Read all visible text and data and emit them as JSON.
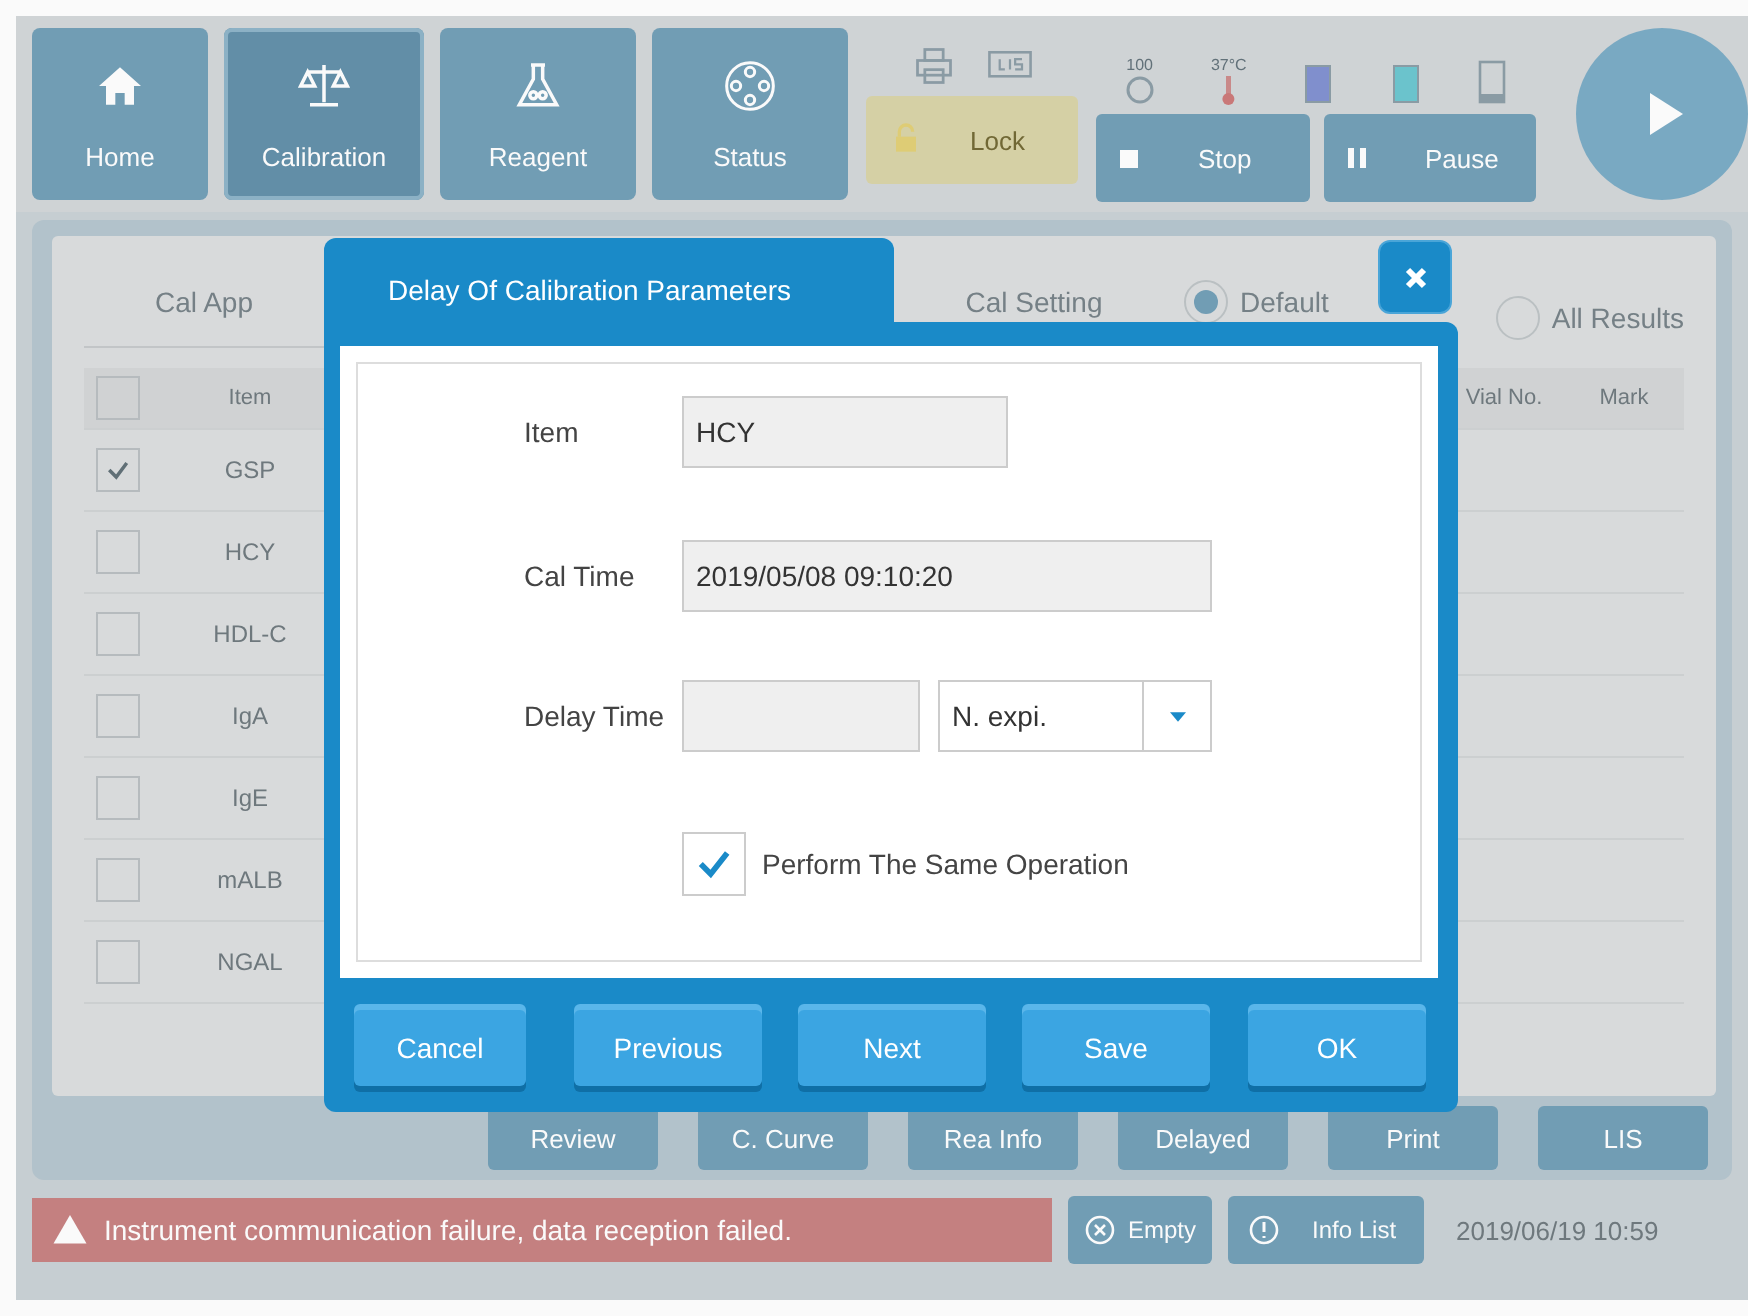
{
  "top_bar": {
    "nav": [
      {
        "label": "Home",
        "selected": false
      },
      {
        "label": "Calibration",
        "selected": true
      },
      {
        "label": "Reagent",
        "selected": false
      },
      {
        "label": "Status",
        "selected": false
      }
    ],
    "sample_count": "100",
    "temperature": "37°C",
    "lock": "Lock",
    "stop": "Stop",
    "pause": "Pause"
  },
  "main": {
    "tabs": [
      {
        "label": "Cal App",
        "selected": false
      },
      {
        "label": "Cal Setting",
        "selected": false
      }
    ],
    "radios": [
      {
        "label": "Default",
        "selected": true
      },
      {
        "label": "All Results",
        "selected": false
      }
    ],
    "table": {
      "columns": [
        "Item",
        "Vial No.",
        "Mark"
      ],
      "header_checked": false,
      "rows": [
        {
          "item": "GSP",
          "checked": true
        },
        {
          "item": "HCY",
          "checked": false
        },
        {
          "item": "HDL-C",
          "checked": false
        },
        {
          "item": "IgA",
          "checked": false
        },
        {
          "item": "IgE",
          "checked": false
        },
        {
          "item": "mALB",
          "checked": false
        },
        {
          "item": "NGAL",
          "checked": false
        }
      ]
    },
    "actions": [
      "Review",
      "C. Curve",
      "Rea Info",
      "Delayed",
      "Print",
      "LIS"
    ]
  },
  "status_bar": {
    "alert": "Instrument communication failure, data reception failed.",
    "buttons": [
      "Empty",
      "Info List"
    ],
    "datetime": "2019/06/19 10:59"
  },
  "dialog": {
    "title": "Delay Of Calibration Parameters",
    "item_label": "Item",
    "item_value": "HCY",
    "cal_time_label": "Cal Time",
    "cal_time_value": "2019/05/08 09:10:20",
    "delay_time_label": "Delay Time",
    "delay_unit": "N. expi.",
    "same_operation": {
      "label": "Perform The Same Operation",
      "checked": true
    },
    "buttons": [
      "Cancel",
      "Previous",
      "Next",
      "Save",
      "OK"
    ]
  }
}
